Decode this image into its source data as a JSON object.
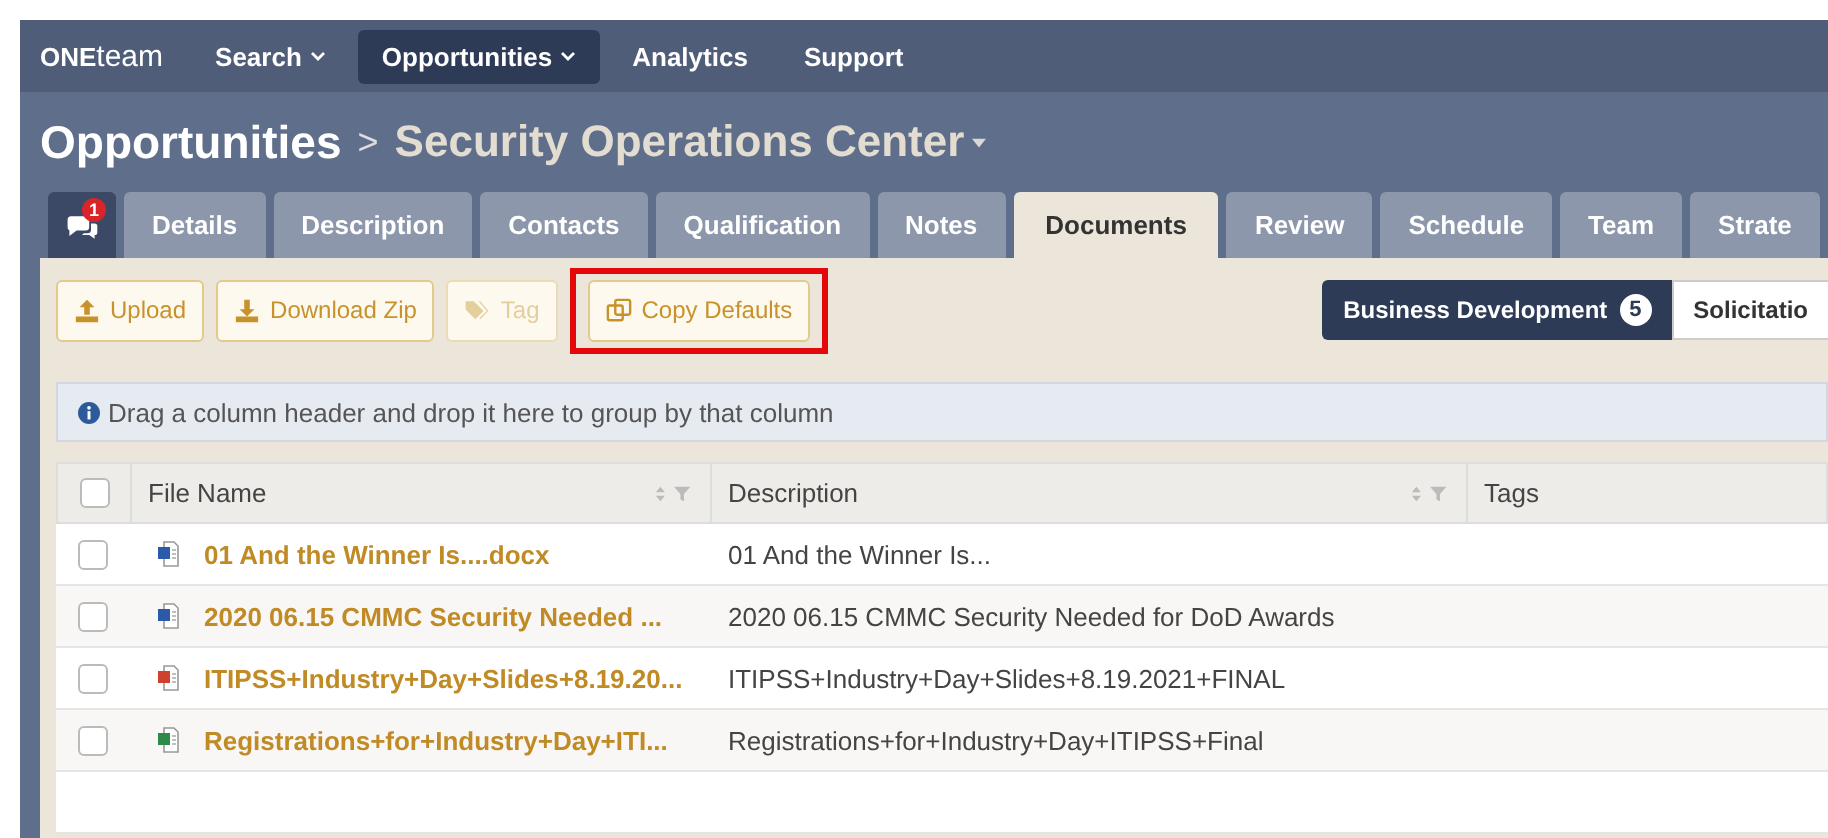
{
  "nav": {
    "logo_bold": "ONE",
    "logo_light": "team",
    "items": [
      {
        "label": "Search",
        "dropdown": true,
        "selected": false
      },
      {
        "label": "Opportunities",
        "dropdown": true,
        "selected": true
      },
      {
        "label": "Analytics",
        "dropdown": false,
        "selected": false
      },
      {
        "label": "Support",
        "dropdown": false,
        "selected": false
      }
    ]
  },
  "breadcrumb": {
    "parent": "Opportunities",
    "separator": ">",
    "current": "Security Operations Center"
  },
  "tabs": {
    "chat_badge": "1",
    "items": [
      {
        "label": "Details",
        "selected": false
      },
      {
        "label": "Description",
        "selected": false
      },
      {
        "label": "Contacts",
        "selected": false
      },
      {
        "label": "Qualification",
        "selected": false
      },
      {
        "label": "Notes",
        "selected": false
      },
      {
        "label": "Documents",
        "selected": true
      },
      {
        "label": "Review",
        "selected": false
      },
      {
        "label": "Schedule",
        "selected": false
      },
      {
        "label": "Team",
        "selected": false
      },
      {
        "label": "Strate",
        "selected": false
      }
    ]
  },
  "toolbar": {
    "buttons": [
      {
        "label": "Upload",
        "kind": "upload",
        "disabled": false,
        "highlighted": false
      },
      {
        "label": "Download Zip",
        "kind": "download",
        "disabled": false,
        "highlighted": false
      },
      {
        "label": "Tag",
        "kind": "tag",
        "disabled": true,
        "highlighted": false
      },
      {
        "label": "Copy Defaults",
        "kind": "copy",
        "disabled": false,
        "highlighted": true
      }
    ],
    "segments": [
      {
        "label": "Business Development",
        "count": "5",
        "selected": true
      },
      {
        "label": "Solicitatio",
        "selected": false
      }
    ]
  },
  "group_hint": "Drag a column header and drop it here to group by that column",
  "table": {
    "select_all_checked": false,
    "columns": [
      {
        "label": "File Name",
        "sortable": true
      },
      {
        "label": "Description",
        "sortable": true
      },
      {
        "label": "Tags",
        "sortable": false
      }
    ],
    "rows": [
      {
        "file": "01 And the Winner Is....docx",
        "kind": "word",
        "description": "01 And the Winner Is...",
        "checked": false
      },
      {
        "file": "2020 06.15 CMMC Security Needed ...",
        "kind": "word",
        "description": "2020 06.15 CMMC Security Needed for DoD Awards",
        "checked": false
      },
      {
        "file": "ITIPSS+Industry+Day+Slides+8.19.20...",
        "kind": "pdf",
        "description": "ITIPSS+Industry+Day+Slides+8.19.2021+FINAL",
        "checked": false
      },
      {
        "file": "Registrations+for+Industry+Day+ITI...",
        "kind": "excel",
        "description": "Registrations+for+Industry+Day+ITIPSS+Final",
        "checked": false
      }
    ]
  }
}
